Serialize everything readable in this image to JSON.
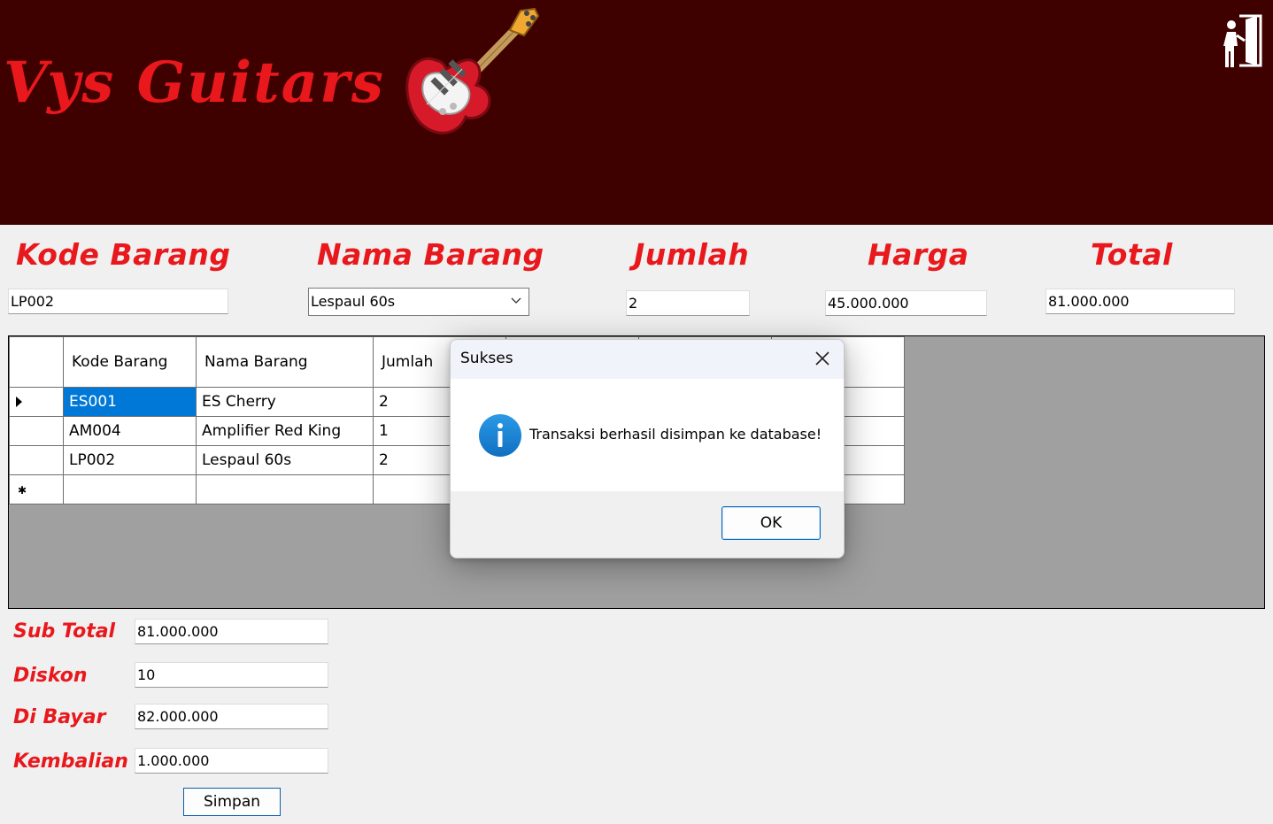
{
  "header": {
    "logo_text": "Vys Guitars",
    "brand_color": "#e8181c",
    "header_background": "#3f0000",
    "icons": {
      "logo": "electric-guitar-icon",
      "exit": "exit-door-icon"
    }
  },
  "form": {
    "labels": {
      "kode_barang": "Kode Barang",
      "nama_barang": "Nama Barang",
      "jumlah": "Jumlah",
      "harga": "Harga",
      "total": "Total"
    },
    "values": {
      "kode_barang": "LP002",
      "nama_barang": "Lespaul 60s",
      "jumlah": "2",
      "harga": "45.000.000",
      "total": "81.000.000"
    }
  },
  "grid": {
    "columns": [
      "Kode Barang",
      "Nama Barang",
      "Jumlah"
    ],
    "rows": [
      {
        "kode": "ES001",
        "nama": "ES Cherry",
        "jumlah": "2"
      },
      {
        "kode": "AM004",
        "nama": "Amplifier Red King",
        "jumlah": "1"
      },
      {
        "kode": "LP002",
        "nama": "Lespaul 60s",
        "jumlah": "2"
      }
    ],
    "selection_color": "#0078d7"
  },
  "summary": {
    "sub_total_label": "Sub Total",
    "sub_total_value": "81.000.000",
    "diskon_label": "Diskon",
    "diskon_value": "10",
    "di_bayar_label": "Di Bayar",
    "di_bayar_value": "82.000.000",
    "kembalian_label": "Kembalian",
    "kembalian_value": "1.000.000",
    "simpan_label": "Simpan"
  },
  "dialog": {
    "title": "Sukses",
    "message": "Transaksi berhasil disimpan ke database!",
    "ok_label": "OK",
    "icon": "info-icon",
    "icon_color": "#1a8ad6"
  }
}
